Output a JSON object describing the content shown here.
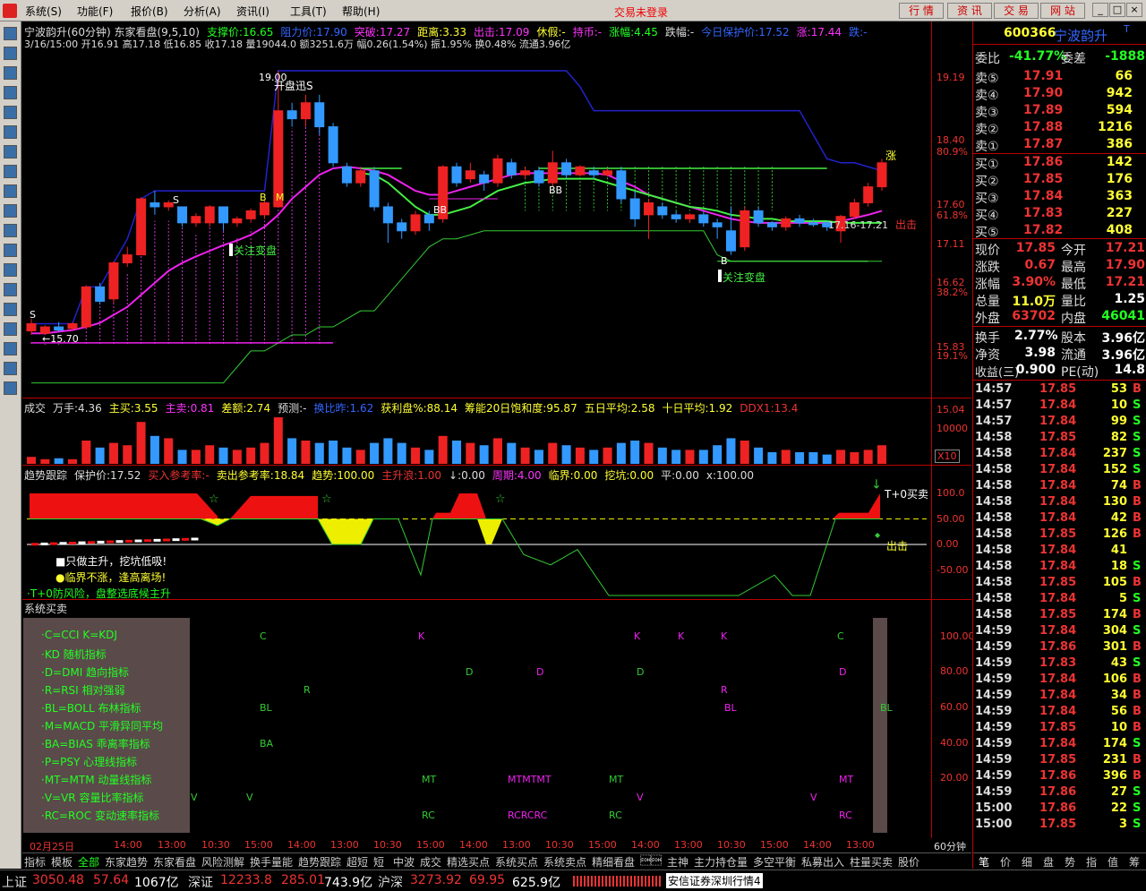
{
  "menu": [
    "系统(S)",
    "功能(F)",
    "报价(B)",
    "分析(A)",
    "资讯(I)",
    "工具(T)",
    "帮助(H)"
  ],
  "login_status": "交易未登录",
  "top_buttons": [
    "行 情",
    "资 讯",
    "交 易",
    "网 站"
  ],
  "main_header": {
    "line1": [
      {
        "t": "宁波韵升(60分钟) 东家看盘(9,5,10)",
        "c": "#ddd"
      },
      {
        "t": "支撑价:16.65",
        "c": "#2f2"
      },
      {
        "t": "阻力价:17.90",
        "c": "#36f"
      },
      {
        "t": "突破:17.27",
        "c": "#f3f"
      },
      {
        "t": "距离:3.33",
        "c": "#ff3"
      },
      {
        "t": "出击:17.09",
        "c": "#f3f"
      },
      {
        "t": "休假:-",
        "c": "#ff3"
      },
      {
        "t": "持币:-",
        "c": "#f3f"
      },
      {
        "t": "涨幅:4.45",
        "c": "#2f2"
      },
      {
        "t": "跌幅:-",
        "c": "#ddd"
      },
      {
        "t": "今日保护价:17.52",
        "c": "#36f"
      },
      {
        "t": "涨:17.44",
        "c": "#f3f"
      },
      {
        "t": "跌:-",
        "c": "#36f"
      }
    ],
    "line2": "3/16/15:00 开16.91 高17.18 低16.85 收17.18 量19044.0 额3251.6万 幅0.26(1.54%) 振1.95% 换0.48% 流通3.96亿"
  },
  "price_axis": [
    "19.19",
    "18.40",
    "80.9%",
    "17.60",
    "61.8%",
    "17.11",
    "16.62",
    "38.2%",
    "15.83",
    "19.1%",
    "15.04"
  ],
  "chart_annotations": {
    "open_label": "开盘迅S",
    "top_price": "19.00",
    "low_price": "←15.70",
    "focus1": "关注变盘",
    "focus2": "关注变盘",
    "zhang": "涨",
    "chuji": "出击",
    "range": "17.16-17.21",
    "labels": [
      "S",
      "S",
      "B",
      "M",
      "BB",
      "BB",
      "B"
    ]
  },
  "volume_header": [
    {
      "t": "成交",
      "c": "#ddd"
    },
    {
      "t": "万手:4.36",
      "c": "#ddd"
    },
    {
      "t": "主买:3.55",
      "c": "#ff3"
    },
    {
      "t": "主卖:0.81",
      "c": "#f3f"
    },
    {
      "t": "差额:2.74",
      "c": "#ff3"
    },
    {
      "t": "预测:-",
      "c": "#ddd"
    },
    {
      "t": "换比昨:1.62",
      "c": "#36f"
    },
    {
      "t": "获利盘%:88.14",
      "c": "#ff3"
    },
    {
      "t": "筹能20日饱和度:95.87",
      "c": "#ff3"
    },
    {
      "t": "五日平均:2.58",
      "c": "#ff3"
    },
    {
      "t": "十日平均:1.92",
      "c": "#ff3"
    },
    {
      "t": "DDX1:13.4",
      "c": "#e33"
    }
  ],
  "volume_axis": [
    "10000",
    "X10"
  ],
  "trend_header": [
    {
      "t": "趋势跟踪",
      "c": "#ddd"
    },
    {
      "t": "保护价:17.52",
      "c": "#ddd"
    },
    {
      "t": "买入参考率:-",
      "c": "#e33"
    },
    {
      "t": "卖出参考率:18.84",
      "c": "#ff3"
    },
    {
      "t": "趋势:100.00",
      "c": "#ff3"
    },
    {
      "t": "主升浪:1.00",
      "c": "#e33"
    },
    {
      "t": "↓:0.00",
      "c": "#ddd"
    },
    {
      "t": "周期:4.00",
      "c": "#f3f"
    },
    {
      "t": "临界:0.00",
      "c": "#ff3"
    },
    {
      "t": "挖坑:0.00",
      "c": "#ff3"
    },
    {
      "t": "平:0.00",
      "c": "#ddd"
    },
    {
      "t": "ⅹ:100.00",
      "c": "#ddd"
    }
  ],
  "trend_axis": [
    "100.0",
    "50.00",
    "0.00",
    "-50.00"
  ],
  "trend_notes": [
    {
      "t": "■只做主升，挖坑低吸!",
      "c": "#fff"
    },
    {
      "t": "●临界不涨，逢高离场!",
      "c": "#ff3"
    },
    {
      "t": "·T+0防风险，盘整选底候主升",
      "c": "#2f2"
    }
  ],
  "trend_right": {
    "buy": "T+0买卖",
    "out": "出击"
  },
  "signal_title": "系统买卖",
  "signal_legend": [
    "·C=CCI   K=KDJ",
    "·KD 随机指标",
    "·D=DMI 趋向指标",
    "·R=RSI 相对强弱",
    "·BL=BOLL 布林指标",
    "·M=MACD 平滑异同平均",
    "·BA=BIAS 乖离率指标",
    "·P=PSY 心理线指标",
    "·MT=MTM 动量线指标",
    "·V=VR 容量比率指标",
    "·RC=ROC 变动速率指标"
  ],
  "signal_axis": [
    "100.00",
    "80.00",
    "60.00",
    "40.00",
    "20.00"
  ],
  "time_axis": [
    "02月25日",
    "14:00",
    "13:00",
    "10:30",
    "15:00",
    "14:00",
    "13:00",
    "10:30",
    "15:00",
    "14:00",
    "13:00",
    "10:30",
    "15:00",
    "14:00",
    "13:00",
    "10:30",
    "15:00",
    "14:00",
    "13:00"
  ],
  "time_unit": "60分钟",
  "bottom_tabs": [
    "指标",
    "模板",
    "全部",
    "东家趋势",
    "东家看盘",
    "风险测解",
    "换手量能",
    "趋势跟踪",
    "超短",
    "短",
    "中波",
    "成交",
    "精选买点",
    "系统买点",
    "系统卖点",
    "精细看盘",
    "\u0001\u0001",
    "主神",
    "主力持仓量",
    "多空平衡",
    "私募出入",
    "柱量买卖",
    "股价"
  ],
  "quote": {
    "code": "600366",
    "name": "宁波韵升",
    "badge": "T",
    "weibi_label": "委比",
    "weibi": "-41.77%",
    "weicha_label": "委差",
    "weicha": "-1888",
    "asks": [
      {
        "l": "卖⑤",
        "p": "17.91",
        "v": "66"
      },
      {
        "l": "卖④",
        "p": "17.90",
        "v": "942"
      },
      {
        "l": "卖③",
        "p": "17.89",
        "v": "594"
      },
      {
        "l": "卖②",
        "p": "17.88",
        "v": "1216"
      },
      {
        "l": "卖①",
        "p": "17.87",
        "v": "386"
      }
    ],
    "bids": [
      {
        "l": "买①",
        "p": "17.86",
        "v": "142"
      },
      {
        "l": "买②",
        "p": "17.85",
        "v": "176"
      },
      {
        "l": "买③",
        "p": "17.84",
        "v": "363"
      },
      {
        "l": "买④",
        "p": "17.83",
        "v": "227"
      },
      {
        "l": "买⑤",
        "p": "17.82",
        "v": "408"
      }
    ],
    "stats": [
      {
        "a": "现价",
        "av": "17.85",
        "ac": "#e33",
        "b": "今开",
        "bv": "17.21",
        "bc": "#e33"
      },
      {
        "a": "涨跌",
        "av": "0.67",
        "ac": "#e33",
        "b": "最高",
        "bv": "17.90",
        "bc": "#e33"
      },
      {
        "a": "涨幅",
        "av": "3.90%",
        "ac": "#e33",
        "b": "最低",
        "bv": "17.21",
        "bc": "#e33"
      },
      {
        "a": "总量",
        "av": "11.0万",
        "ac": "#ff3",
        "b": "量比",
        "bv": "1.25",
        "bc": "#fff"
      },
      {
        "a": "外盘",
        "av": "63702",
        "ac": "#e33",
        "b": "内盘",
        "bv": "46041",
        "bc": "#2f2"
      }
    ],
    "stats2": [
      {
        "a": "换手",
        "av": "2.77%",
        "b": "股本",
        "bv": "3.96亿"
      },
      {
        "a": "净资",
        "av": "3.98",
        "b": "流通",
        "bv": "3.96亿"
      },
      {
        "a": "收益(三)",
        "av": "0.900",
        "b": "PE(动)",
        "bv": "14.8"
      }
    ],
    "ticks": [
      [
        "14:57",
        "17.85",
        "53",
        "B"
      ],
      [
        "14:57",
        "17.84",
        "10",
        "S"
      ],
      [
        "14:57",
        "17.84",
        "99",
        "S"
      ],
      [
        "14:58",
        "17.85",
        "82",
        "S"
      ],
      [
        "14:58",
        "17.84",
        "237",
        "S"
      ],
      [
        "14:58",
        "17.84",
        "152",
        "S"
      ],
      [
        "14:58",
        "17.84",
        "74",
        "B"
      ],
      [
        "14:58",
        "17.84",
        "130",
        "B"
      ],
      [
        "14:58",
        "17.84",
        "42",
        "B"
      ],
      [
        "14:58",
        "17.85",
        "126",
        "B"
      ],
      [
        "14:58",
        "17.84",
        "41",
        ""
      ],
      [
        "14:58",
        "17.84",
        "18",
        "S"
      ],
      [
        "14:58",
        "17.85",
        "105",
        "B"
      ],
      [
        "14:58",
        "17.84",
        "5",
        "S"
      ],
      [
        "14:58",
        "17.85",
        "174",
        "B"
      ],
      [
        "14:59",
        "17.84",
        "304",
        "S"
      ],
      [
        "14:59",
        "17.86",
        "301",
        "B"
      ],
      [
        "14:59",
        "17.83",
        "43",
        "S"
      ],
      [
        "14:59",
        "17.84",
        "106",
        "B"
      ],
      [
        "14:59",
        "17.84",
        "34",
        "B"
      ],
      [
        "14:59",
        "17.84",
        "56",
        "B"
      ],
      [
        "14:59",
        "17.85",
        "10",
        "B"
      ],
      [
        "14:59",
        "17.84",
        "174",
        "S"
      ],
      [
        "14:59",
        "17.85",
        "231",
        "B"
      ],
      [
        "14:59",
        "17.86",
        "396",
        "B"
      ],
      [
        "14:59",
        "17.86",
        "27",
        "S"
      ],
      [
        "15:00",
        "17.86",
        "22",
        "S"
      ],
      [
        "15:00",
        "17.85",
        "3",
        "S"
      ]
    ],
    "tabs": [
      "笔",
      "价",
      "细",
      "盘",
      "势",
      "指",
      "值",
      "筹"
    ]
  },
  "index_bar": [
    {
      "t": "上证",
      "c": "#ddd"
    },
    {
      "t": "3050.48",
      "c": "#e33"
    },
    {
      "t": "57.64",
      "c": "#e33"
    },
    {
      "t": "1067亿",
      "c": "#fff"
    },
    {
      "t": "深证",
      "c": "#ddd"
    },
    {
      "t": "12233.8",
      "c": "#e33"
    },
    {
      "t": "285.01",
      "c": "#e33"
    },
    {
      "t": "743.9亿",
      "c": "#fff"
    },
    {
      "t": "沪深",
      "c": "#ddd"
    },
    {
      "t": "3273.92",
      "c": "#e33"
    },
    {
      "t": "69.95",
      "c": "#e33"
    },
    {
      "t": "625.9亿",
      "c": "#fff"
    },
    {
      "t": "安信证券深圳行情4",
      "c": "#000"
    }
  ]
}
